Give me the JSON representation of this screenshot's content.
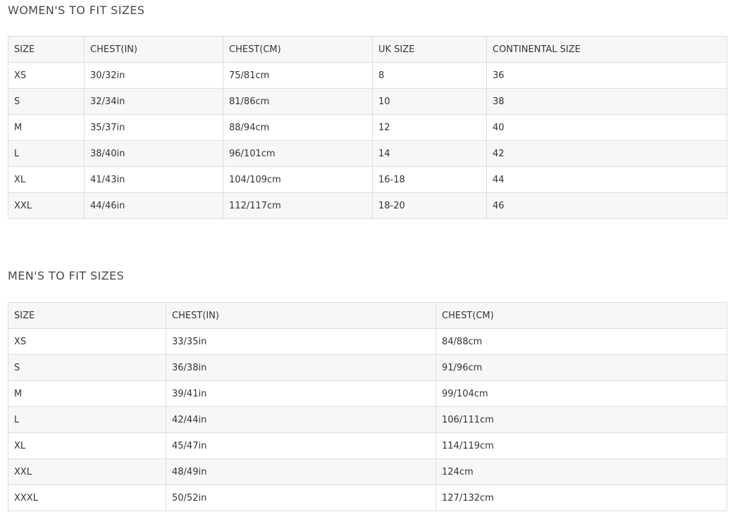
{
  "women": {
    "title": "WOMEN'S TO FIT SIZES",
    "headers": [
      "SIZE",
      "CHEST(IN)",
      "CHEST(CM)",
      "UK SIZE",
      "CONTINENTAL SIZE"
    ],
    "rows": [
      [
        "XS",
        "30/32in",
        "75/81cm",
        "8",
        "36"
      ],
      [
        "S",
        "32/34in",
        "81/86cm",
        "10",
        "38"
      ],
      [
        "M",
        "35/37in",
        "88/94cm",
        "12",
        "40"
      ],
      [
        "L",
        "38/40in",
        "96/101cm",
        "14",
        "42"
      ],
      [
        "XL",
        "41/43in",
        "104/109cm",
        "16-18",
        "44"
      ],
      [
        "XXL",
        "44/46in",
        "112/117cm",
        "18-20",
        "46"
      ]
    ]
  },
  "men": {
    "title": "MEN'S TO FIT SIZES",
    "headers": [
      "SIZE",
      "CHEST(IN)",
      "CHEST(CM)"
    ],
    "rows": [
      [
        "XS",
        "33/35in",
        "84/88cm"
      ],
      [
        "S",
        "36/38in",
        "91/96cm"
      ],
      [
        "M",
        "39/41in",
        "99/104cm"
      ],
      [
        "L",
        "42/44in",
        "106/111cm"
      ],
      [
        "XL",
        "45/47in",
        "114/119cm"
      ],
      [
        "XXL",
        "48/49in",
        "124cm"
      ],
      [
        "XXXL",
        "50/52in",
        "127/132cm"
      ]
    ]
  }
}
